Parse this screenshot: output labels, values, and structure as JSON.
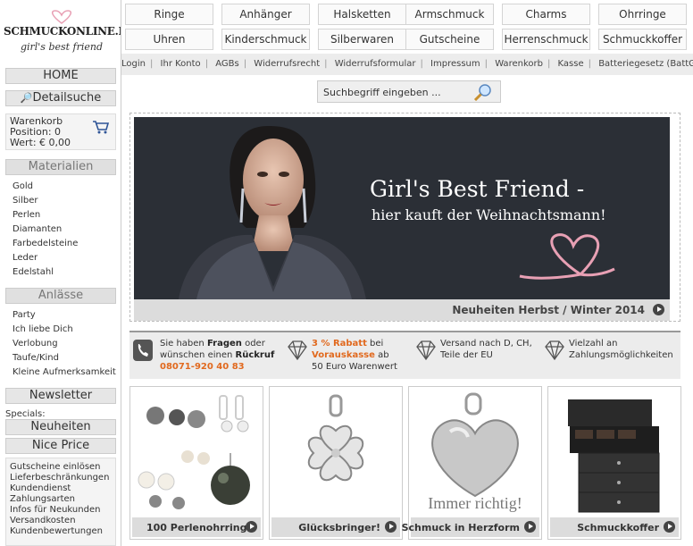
{
  "brand": {
    "name": "SCHMUCKONLINE.DE",
    "tagline": "girl's best friend"
  },
  "sidebar": {
    "home": "HOME",
    "detail_search": "Detailsuche",
    "cart": {
      "title": "Warenkorb",
      "position": "Position: 0",
      "value": "Wert: € 0,00"
    },
    "materials": {
      "title": "Materialien",
      "items": [
        "Gold",
        "Silber",
        "Perlen",
        "Diamanten",
        "Farbedelsteine",
        "Leder",
        "Edelstahl"
      ]
    },
    "occasions": {
      "title": "Anlässe",
      "items": [
        "Party",
        "Ich liebe Dich",
        "Verlobung",
        "Taufe/Kind",
        "Kleine Aufmerksamkeit"
      ]
    },
    "newsletter": "Newsletter",
    "specials_label": "Specials:",
    "new_items": "Neuheiten",
    "nice_price": "Nice Price",
    "info_links": [
      "Gutscheine einlösen",
      "Lieferbeschränkungen",
      "Kundendienst",
      "Zahlungsarten",
      "Infos für Neukunden",
      "Versandkosten",
      "Kundenbewertungen"
    ]
  },
  "nav": {
    "row1": [
      "Ringe",
      "Anhänger",
      "Halsketten",
      "Armschmuck",
      "Charms",
      "Ohrringe"
    ],
    "row2": [
      "Uhren",
      "Kinderschmuck",
      "Silberwaren",
      "Gutscheine",
      "Herrenschmuck",
      "Schmuckkoffer"
    ],
    "links": [
      "Login",
      "Ihr Konto",
      "AGBs",
      "Widerrufsrecht",
      "Widerrufsformular",
      "Impressum",
      "Warenkorb",
      "Kasse",
      "Batteriegesetz (BattG)"
    ]
  },
  "search": {
    "placeholder": "Suchbegriff eingeben ..."
  },
  "banner": {
    "headline": "Girl's Best Friend -",
    "subline": "hier kauft der Weihnachtsmann!",
    "caption": "Neuheiten Herbst / Winter 2014"
  },
  "infobar": {
    "contact": {
      "pre": "Sie haben ",
      "b1": "Fragen",
      "mid": " oder wünschen einen ",
      "b2": "Rückruf",
      "phone": "08071-920 40 83"
    },
    "discount": {
      "highlight": "3 % Rabatt",
      "mid": " bei ",
      "highlight2": "Vorauskasse",
      "post": " ab 50 Euro Warenwert"
    },
    "shipping": "Versand nach D, CH, Teile der EU",
    "payment": "Vielzahl an Zahlungsmöglichkeiten"
  },
  "products": [
    {
      "label": "100 Perlenohrringe"
    },
    {
      "label": "Glücksbringer!"
    },
    {
      "label": "Schmuck in Herzform",
      "overlay": "Immer richtig!"
    },
    {
      "label": "Schmuckkoffer"
    }
  ],
  "colors": {
    "accent": "#e1691e",
    "heart": "#e8a0b4",
    "banner_bg": "#2b2f36"
  }
}
